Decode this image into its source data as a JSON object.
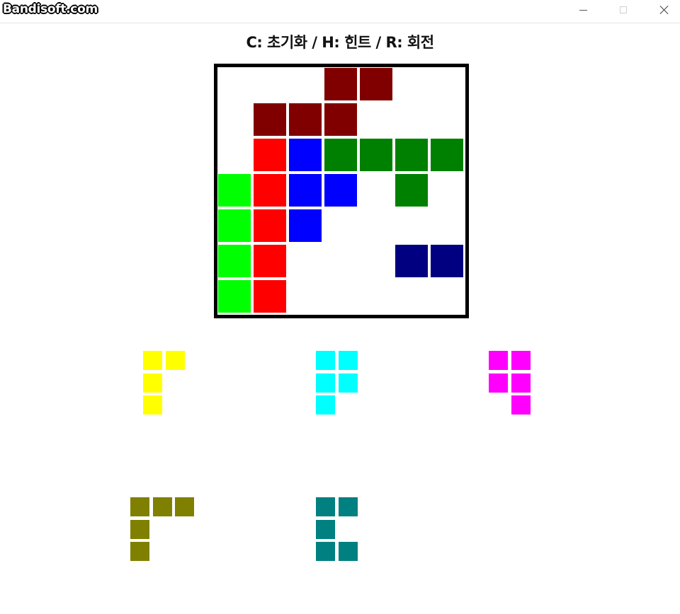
{
  "window": {
    "watermark": "Bandisoft.com"
  },
  "instructions": "C: 초기화 / H: 힌트 / R: 회전",
  "colors": {
    "maroon": "#800000",
    "red": "#ff0000",
    "blue": "#0000ff",
    "green": "#008000",
    "lime": "#00ff00",
    "navy": "#000080",
    "yellow": "#ffff00",
    "cyan": "#00ffff",
    "magenta": "#ff00ff",
    "olive": "#808000",
    "teal": "#008080"
  },
  "board": {
    "rows": 7,
    "cols": 7,
    "placed": [
      {
        "row": 0,
        "col": 3,
        "color": "maroon"
      },
      {
        "row": 0,
        "col": 4,
        "color": "maroon"
      },
      {
        "row": 1,
        "col": 1,
        "color": "maroon"
      },
      {
        "row": 1,
        "col": 2,
        "color": "maroon"
      },
      {
        "row": 1,
        "col": 3,
        "color": "maroon"
      },
      {
        "row": 2,
        "col": 1,
        "color": "red"
      },
      {
        "row": 3,
        "col": 1,
        "color": "red"
      },
      {
        "row": 4,
        "col": 1,
        "color": "red"
      },
      {
        "row": 5,
        "col": 1,
        "color": "red"
      },
      {
        "row": 6,
        "col": 1,
        "color": "red"
      },
      {
        "row": 2,
        "col": 2,
        "color": "blue"
      },
      {
        "row": 3,
        "col": 2,
        "color": "blue"
      },
      {
        "row": 3,
        "col": 3,
        "color": "blue"
      },
      {
        "row": 4,
        "col": 2,
        "color": "blue"
      },
      {
        "row": 2,
        "col": 3,
        "color": "green"
      },
      {
        "row": 2,
        "col": 4,
        "color": "green"
      },
      {
        "row": 2,
        "col": 5,
        "color": "green"
      },
      {
        "row": 2,
        "col": 6,
        "color": "green"
      },
      {
        "row": 3,
        "col": 5,
        "color": "green"
      },
      {
        "row": 3,
        "col": 0,
        "color": "lime"
      },
      {
        "row": 4,
        "col": 0,
        "color": "lime"
      },
      {
        "row": 5,
        "col": 0,
        "color": "lime"
      },
      {
        "row": 6,
        "col": 0,
        "color": "lime"
      },
      {
        "row": 5,
        "col": 5,
        "color": "navy"
      },
      {
        "row": 5,
        "col": 6,
        "color": "navy"
      }
    ]
  },
  "tray": [
    {
      "name": "yellow",
      "color": "yellow",
      "cells": [
        [
          0,
          0
        ],
        [
          0,
          1
        ],
        [
          1,
          0
        ],
        [
          2,
          0
        ]
      ]
    },
    {
      "name": "cyan",
      "color": "cyan",
      "cells": [
        [
          0,
          0
        ],
        [
          0,
          1
        ],
        [
          1,
          0
        ],
        [
          1,
          1
        ],
        [
          2,
          0
        ]
      ]
    },
    {
      "name": "magenta",
      "color": "magenta",
      "cells": [
        [
          0,
          0
        ],
        [
          0,
          1
        ],
        [
          1,
          0
        ],
        [
          1,
          1
        ],
        [
          2,
          1
        ]
      ]
    },
    {
      "name": "olive",
      "color": "olive",
      "cells": [
        [
          0,
          0
        ],
        [
          0,
          1
        ],
        [
          0,
          2
        ],
        [
          1,
          0
        ],
        [
          2,
          0
        ]
      ]
    },
    {
      "name": "teal",
      "color": "teal",
      "cells": [
        [
          0,
          0
        ],
        [
          0,
          1
        ],
        [
          1,
          0
        ],
        [
          2,
          0
        ],
        [
          2,
          1
        ]
      ]
    }
  ]
}
